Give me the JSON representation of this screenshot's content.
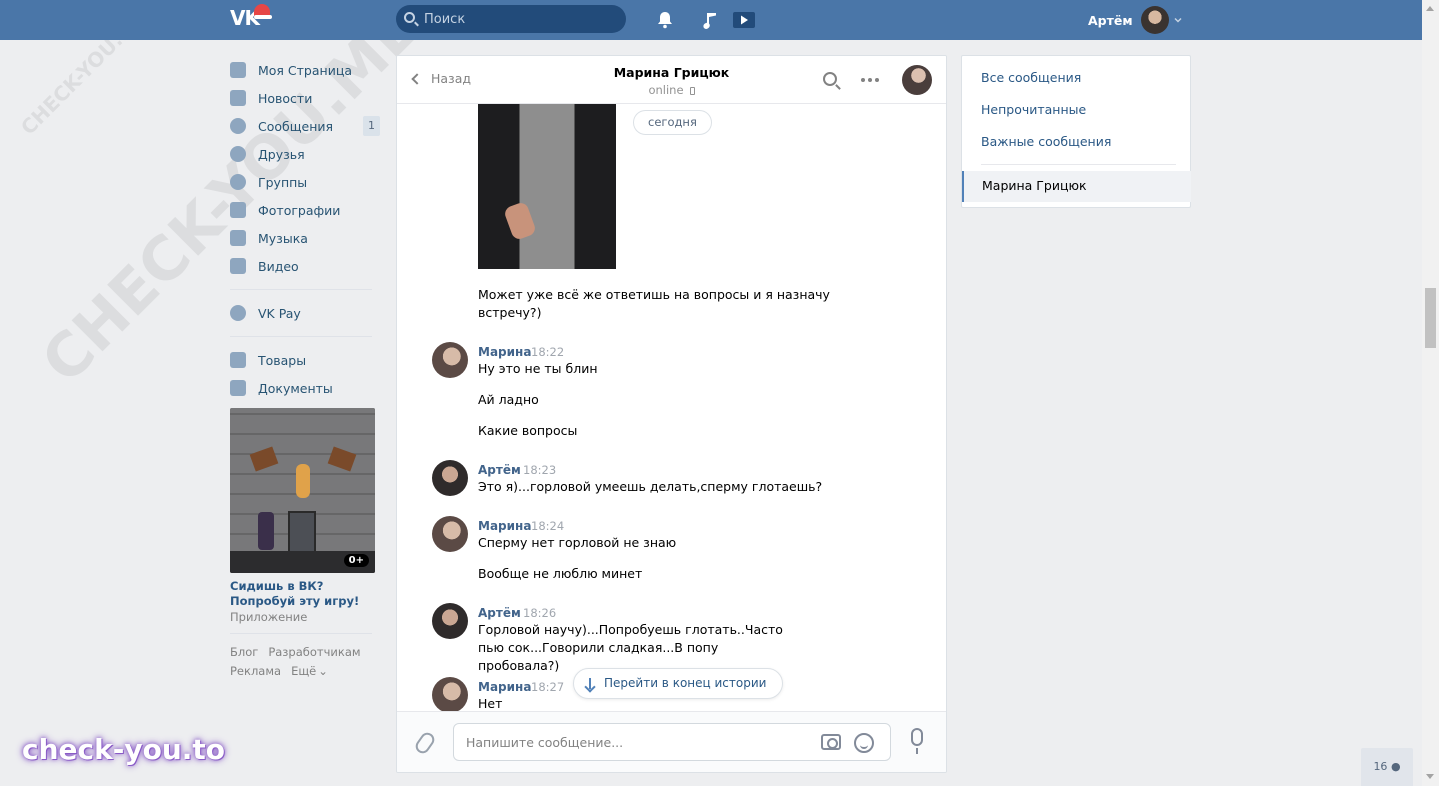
{
  "header": {
    "logo": "VK",
    "search_placeholder": "Поиск",
    "user_name": "Артём",
    "icons": [
      "bell-icon",
      "music-note-icon",
      "video-play-icon"
    ]
  },
  "watermark": {
    "big": "CHECK-YOU.ME",
    "small": "CHECK-YOU.ME",
    "brand": "check-you.to"
  },
  "left_menu": {
    "items": [
      {
        "label": "Моя Страница",
        "icon": "home-icon"
      },
      {
        "label": "Новости",
        "icon": "news-icon"
      },
      {
        "label": "Сообщения",
        "icon": "messages-icon",
        "badge": "1"
      },
      {
        "label": "Друзья",
        "icon": "friend-icon"
      },
      {
        "label": "Группы",
        "icon": "groups-icon"
      },
      {
        "label": "Фотографии",
        "icon": "camera-icon"
      },
      {
        "label": "Музыка",
        "icon": "music-icon"
      },
      {
        "label": "Видео",
        "icon": "film-icon"
      }
    ],
    "vkpay": {
      "label": "VK Pay",
      "icon": "vkpay-icon"
    },
    "extra": [
      {
        "label": "Товары",
        "icon": "bag-icon"
      },
      {
        "label": "Документы",
        "icon": "document-icon"
      }
    ],
    "ad": {
      "age_badge": "0+",
      "title": "Сидишь в ВК? Попробуй эту игру!",
      "subtitle": "Приложение"
    },
    "footer": {
      "blog": "Блог",
      "developers": "Разработчикам",
      "ads": "Реклама",
      "more": "Ещё"
    }
  },
  "chat": {
    "back_label": "Назад",
    "peer_name": "Марина Грицюк",
    "peer_status": "online",
    "date_pill": "сегодня",
    "photo_caption": "Может уже всё же ответишь на вопросы и я назначу встречу?)",
    "messages": [
      {
        "author": "Марина",
        "time": "18:22",
        "lines": [
          "Ну это не ты блин",
          "Ай ладно",
          "Какие вопросы"
        ]
      },
      {
        "author": "Артём",
        "time": "18:23",
        "lines": [
          "Это я)...горловой умеешь делать,сперму глотаешь?"
        ]
      },
      {
        "author": "Марина",
        "time": "18:24",
        "lines": [
          "Сперму нет горловой не знаю",
          "Вообще не люблю минет"
        ]
      },
      {
        "author": "Артём",
        "time": "18:26",
        "lines": [
          "Горловой научу)...Попробуешь глотать..Часто пью сок...Говорили сладкая...В попу пробовала?)"
        ]
      },
      {
        "author": "Марина",
        "time": "18:27",
        "lines": [
          "Нет"
        ]
      }
    ],
    "scroll_to_end": "Перейти в конец истории",
    "composer_placeholder": "Напишите сообщение..."
  },
  "right_menu": {
    "all": "Все сообщения",
    "unread": "Непрочитанные",
    "important": "Важные сообщения",
    "active_chat": "Марина Грицюк"
  },
  "online_counter": "16"
}
